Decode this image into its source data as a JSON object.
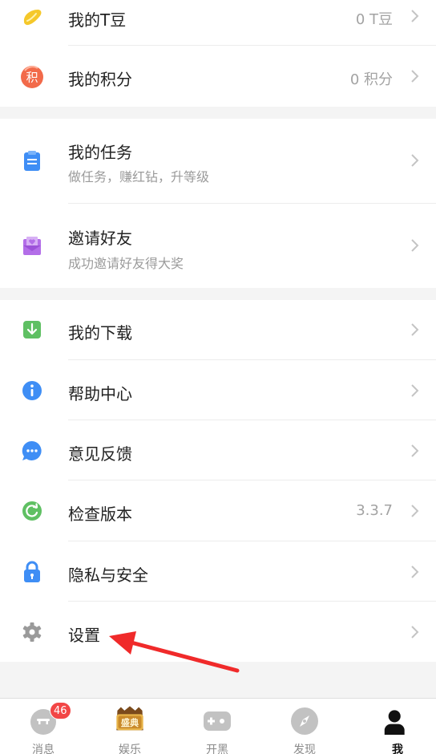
{
  "colors": {
    "accent_red": "#f02a2a",
    "badge": "#f24646"
  },
  "groups": [
    {
      "items": [
        {
          "icon": "bean-icon",
          "title": "我的T豆",
          "value": "0 T豆"
        },
        {
          "icon": "points-icon",
          "title": "我的积分",
          "value": "0 积分"
        }
      ]
    },
    {
      "items": [
        {
          "icon": "task-icon",
          "title": "我的任务",
          "subtitle": "做任务，赚红钻，升等级"
        },
        {
          "icon": "invite-icon",
          "title": "邀请好友",
          "subtitle": "成功邀请好友得大奖"
        }
      ]
    },
    {
      "items": [
        {
          "icon": "download-icon",
          "title": "我的下载"
        },
        {
          "icon": "info-icon",
          "title": "帮助中心"
        },
        {
          "icon": "feedback-icon",
          "title": "意见反馈"
        },
        {
          "icon": "refresh-icon",
          "title": "检查版本",
          "value": "3.3.7"
        },
        {
          "icon": "lock-icon",
          "title": "隐私与安全"
        },
        {
          "icon": "gear-icon",
          "title": "设置"
        }
      ]
    }
  ],
  "points_glyph": "积",
  "tabbar": {
    "tabs": [
      {
        "label": "消息",
        "icon": "message-icon",
        "badge": "46"
      },
      {
        "label": "娱乐",
        "icon": "entertainment-icon",
        "icon_text": "盛典"
      },
      {
        "label": "开黑",
        "icon": "gamepad-icon"
      },
      {
        "label": "发现",
        "icon": "compass-icon"
      },
      {
        "label": "我",
        "icon": "person-icon",
        "active": true
      }
    ]
  }
}
